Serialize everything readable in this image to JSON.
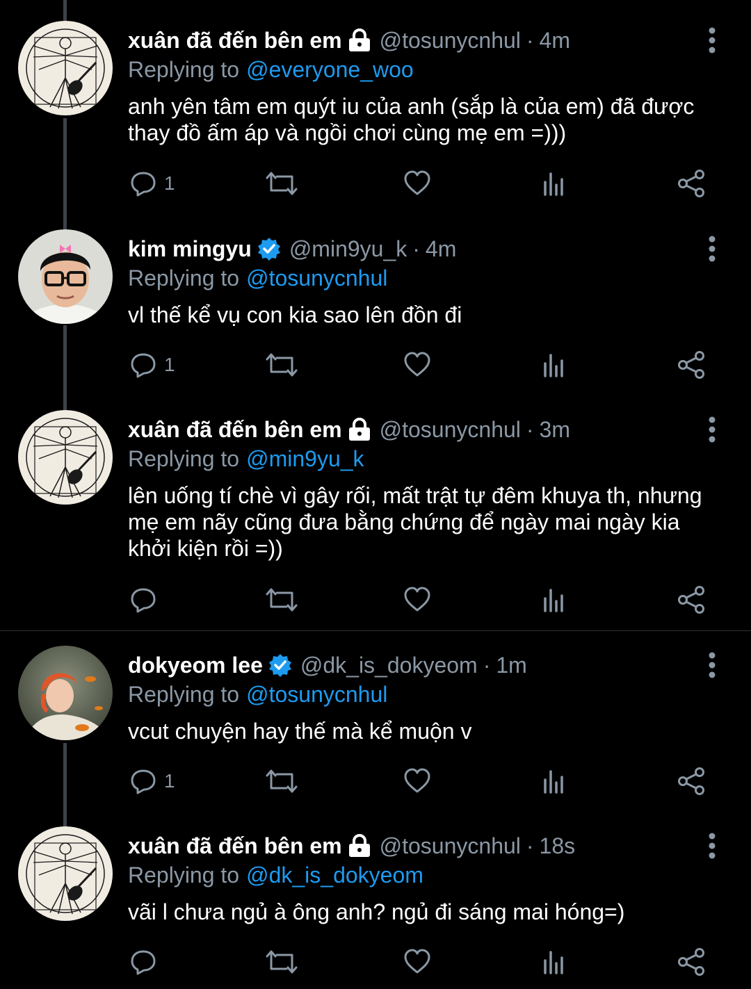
{
  "colors": {
    "background": "#000000",
    "muted": "#8b98a5",
    "accent": "#1d9bf0",
    "thread_line": "#3d4349"
  },
  "labels": {
    "replying_to": "Replying to",
    "separator": "·"
  },
  "tweets": [
    {
      "avatar": "vitruvian-guitar-avatar",
      "name": "xuân đã đến bên em",
      "badge": "lock-icon",
      "handle": "@tosunycnhul",
      "time": "4m",
      "replying_to": "@everyone_woo",
      "text": [
        "anh yên tâm em quýt iu của anh (sắp là của em) đã được",
        "thay đồ ấm áp và ngồi chơi cùng mẹ em =)))"
      ],
      "reply_count": "1"
    },
    {
      "avatar": "mingyu-avatar",
      "name": "kim mingyu",
      "badge": "verified-icon",
      "handle": "@min9yu_k",
      "time": "4m",
      "replying_to": "@tosunycnhul",
      "text": [
        "vl thế kể vụ con kia sao lên đồn đi"
      ],
      "reply_count": "1"
    },
    {
      "avatar": "vitruvian-guitar-avatar",
      "name": "xuân đã đến bên em",
      "badge": "lock-icon",
      "handle": "@tosunycnhul",
      "time": "3m",
      "replying_to": "@min9yu_k",
      "text": [
        "lên uống tí chè vì gây rối, mất trật tự đêm khuya th, nhưng",
        "mẹ em nãy cũng đưa bằng chứng để ngày mai ngày kia",
        "khởi kiện rồi =))"
      ],
      "reply_count": ""
    },
    {
      "avatar": "dokyeom-avatar",
      "name": "dokyeom lee",
      "badge": "verified-icon",
      "handle": "@dk_is_dokyeom",
      "time": "1m",
      "replying_to": "@tosunycnhul",
      "text": [
        "vcut chuyện hay thế mà kể muộn v"
      ],
      "reply_count": "1"
    },
    {
      "avatar": "vitruvian-guitar-avatar",
      "name": "xuân đã đến bên em",
      "badge": "lock-icon",
      "handle": "@tosunycnhul",
      "time": "18s",
      "replying_to": "@dk_is_dokyeom",
      "text": [
        "vãi l chưa ngủ à ông anh? ngủ đi sáng mai hóng=)"
      ],
      "reply_count": ""
    }
  ]
}
